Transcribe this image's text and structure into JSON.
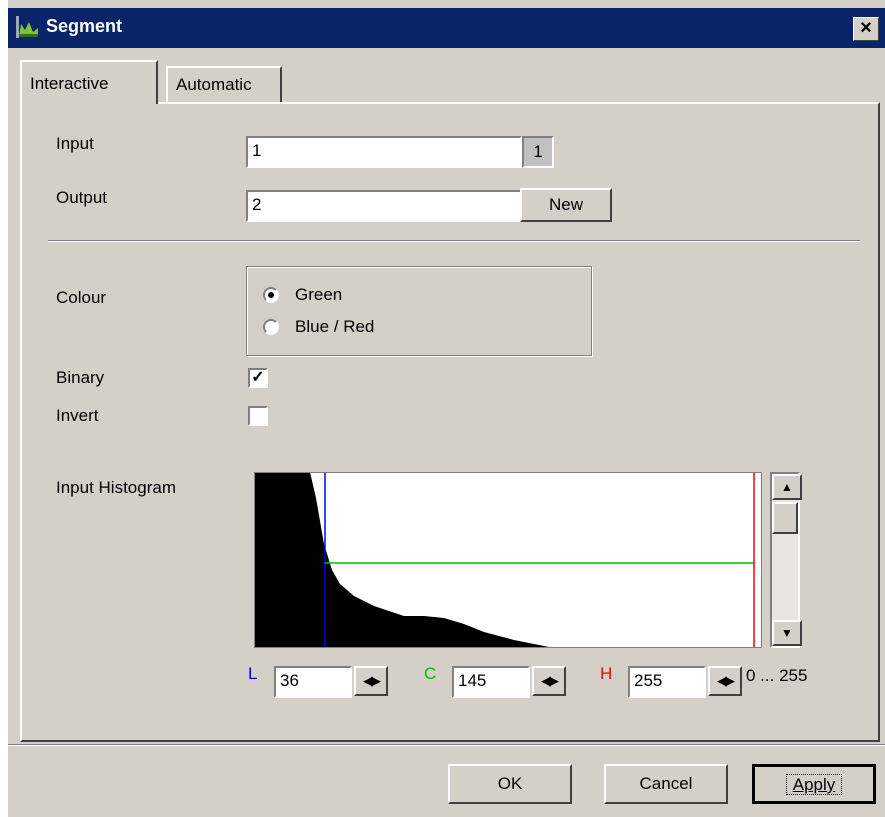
{
  "window": {
    "title": "Segment",
    "icon": "histogram-app-icon",
    "close_glyph": "×"
  },
  "tabs": [
    {
      "label": "Interactive",
      "active": true
    },
    {
      "label": "Automatic",
      "active": false
    }
  ],
  "input": {
    "label": "Input",
    "value": "1",
    "button_label": "1"
  },
  "output": {
    "label": "Output",
    "value": "2",
    "button_label": "New"
  },
  "colour": {
    "label": "Colour",
    "options": [
      {
        "label": "Green",
        "selected": true
      },
      {
        "label": "Blue / Red",
        "selected": false
      }
    ]
  },
  "binary": {
    "label": "Binary",
    "checked": true,
    "check_glyph": "✓"
  },
  "invert": {
    "label": "Invert",
    "checked": false
  },
  "histogram": {
    "label": "Input Histogram",
    "line_colors": {
      "low": "#0000ff",
      "center": "#00c000",
      "high": "#ff0000"
    },
    "l": {
      "letter": "L",
      "value": "36",
      "color": "#0000ff"
    },
    "c": {
      "letter": "C",
      "value": "145",
      "color": "#00c000"
    },
    "h": {
      "letter": "H",
      "value": "255",
      "color": "#ff0000"
    },
    "range_text": "0 ... 255",
    "spin_glyph": "◀▶",
    "scroll_up": "▲",
    "scroll_down": "▼"
  },
  "footer": {
    "ok": "OK",
    "cancel": "Cancel",
    "apply": "Apply"
  }
}
